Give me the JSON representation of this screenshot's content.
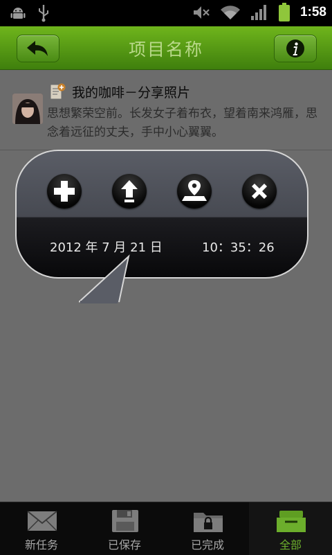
{
  "status_bar": {
    "time": "1:58"
  },
  "header": {
    "title": "项目名称"
  },
  "post": {
    "title": "我的咖啡－分享照片",
    "body": "思想繁荣空前。长发女子着布衣，望着南来鸿雁，思念着远征的丈夫，手中小心翼翼。"
  },
  "popup": {
    "date": "2012 年 7 月 21 日",
    "time": "10：35：26"
  },
  "tabs": [
    {
      "label": "新任务",
      "icon": "envelope-icon"
    },
    {
      "label": "已保存",
      "icon": "floppy-disk-icon"
    },
    {
      "label": "已完成",
      "icon": "locked-folder-icon"
    },
    {
      "label": "全部",
      "icon": "inbox-tray-icon",
      "active": true
    }
  ],
  "colors": {
    "header_green": "#5a9c17",
    "active_tab": "#6cae2c"
  }
}
